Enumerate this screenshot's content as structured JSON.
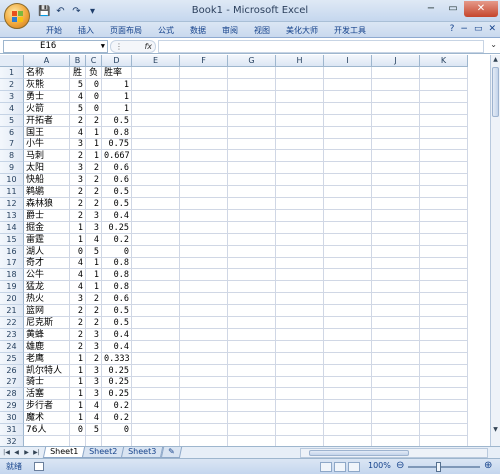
{
  "window": {
    "title": "Book1 - Microsoft Excel"
  },
  "quick_access": {
    "save": "💾",
    "undo": "↶",
    "redo": "↷",
    "customize": "▾"
  },
  "ribbon": {
    "tabs": [
      "开始",
      "插入",
      "页面布局",
      "公式",
      "数据",
      "审阅",
      "视图",
      "美化大师",
      "开发工具"
    ],
    "help": "?",
    "minimize": "−",
    "restore": "▭",
    "close": "✕"
  },
  "formula_bar": {
    "name_box": "E16",
    "fx_label": "fx",
    "formula": ""
  },
  "columns": [
    "A",
    "B",
    "C",
    "D",
    "E",
    "F",
    "G",
    "H",
    "I",
    "J",
    "K"
  ],
  "rows": [
    [
      "名称",
      "胜",
      "负",
      "胜率"
    ],
    [
      "灰熊",
      "5",
      "0",
      "1"
    ],
    [
      "勇士",
      "4",
      "0",
      "1"
    ],
    [
      "火箭",
      "5",
      "0",
      "1"
    ],
    [
      "开拓者",
      "2",
      "2",
      "0.5"
    ],
    [
      "国王",
      "4",
      "1",
      "0.8"
    ],
    [
      "小牛",
      "3",
      "1",
      "0.75"
    ],
    [
      "马刺",
      "2",
      "1",
      "0.667"
    ],
    [
      "太阳",
      "3",
      "2",
      "0.6"
    ],
    [
      "快船",
      "3",
      "2",
      "0.6"
    ],
    [
      "鹈鹕",
      "2",
      "2",
      "0.5"
    ],
    [
      "森林狼",
      "2",
      "2",
      "0.5"
    ],
    [
      "爵士",
      "2",
      "3",
      "0.4"
    ],
    [
      "掘金",
      "1",
      "3",
      "0.25"
    ],
    [
      "雷霆",
      "1",
      "4",
      "0.2"
    ],
    [
      "湖人",
      "0",
      "5",
      "0"
    ],
    [
      "奇才",
      "4",
      "1",
      "0.8"
    ],
    [
      "公牛",
      "4",
      "1",
      "0.8"
    ],
    [
      "猛龙",
      "4",
      "1",
      "0.8"
    ],
    [
      "热火",
      "3",
      "2",
      "0.6"
    ],
    [
      "篮网",
      "2",
      "2",
      "0.5"
    ],
    [
      "尼克斯",
      "2",
      "2",
      "0.5"
    ],
    [
      "黄蜂",
      "2",
      "3",
      "0.4"
    ],
    [
      "雄鹿",
      "2",
      "3",
      "0.4"
    ],
    [
      "老鹰",
      "1",
      "2",
      "0.333"
    ],
    [
      "凯尔特人",
      "1",
      "3",
      "0.25"
    ],
    [
      "骑士",
      "1",
      "3",
      "0.25"
    ],
    [
      "活塞",
      "1",
      "3",
      "0.25"
    ],
    [
      "步行者",
      "1",
      "4",
      "0.2"
    ],
    [
      "魔术",
      "1",
      "4",
      "0.2"
    ],
    [
      "76人",
      "0",
      "5",
      "0"
    ],
    [
      "",
      "",
      "",
      ""
    ]
  ],
  "sheets": [
    "Sheet1",
    "Sheet2",
    "Sheet3"
  ],
  "status": {
    "ready": "就绪",
    "zoom": "100%",
    "minus": "⊖",
    "plus": "⊕"
  }
}
